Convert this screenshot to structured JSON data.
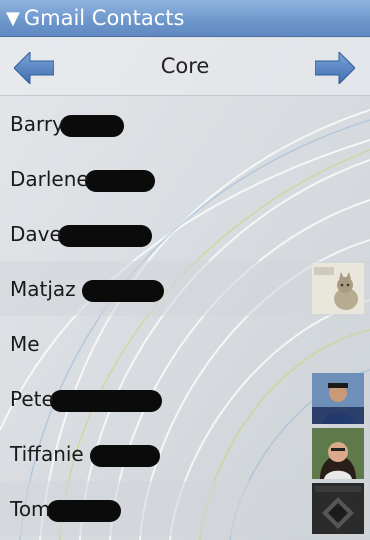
{
  "window": {
    "title": "Gmail Contacts",
    "collapse_glyph": "▼"
  },
  "nav": {
    "group_title": "Core",
    "prev_icon": "left-arrow-icon",
    "next_icon": "right-arrow-icon"
  },
  "contacts": [
    {
      "name": "Barry",
      "has_photo": false
    },
    {
      "name": "Darlene",
      "has_photo": false
    },
    {
      "name": "Dave",
      "has_photo": false
    },
    {
      "name": "Matjaz",
      "has_photo": true
    },
    {
      "name": "Me",
      "has_photo": false
    },
    {
      "name": "Pete",
      "has_photo": true
    },
    {
      "name": "Tiffanie",
      "has_photo": true
    },
    {
      "name": "Tom",
      "has_photo": true
    }
  ],
  "colors": {
    "titlebar": "#6f98cc",
    "arrow": "#4f7fc0",
    "text": "#1a1a1a"
  }
}
